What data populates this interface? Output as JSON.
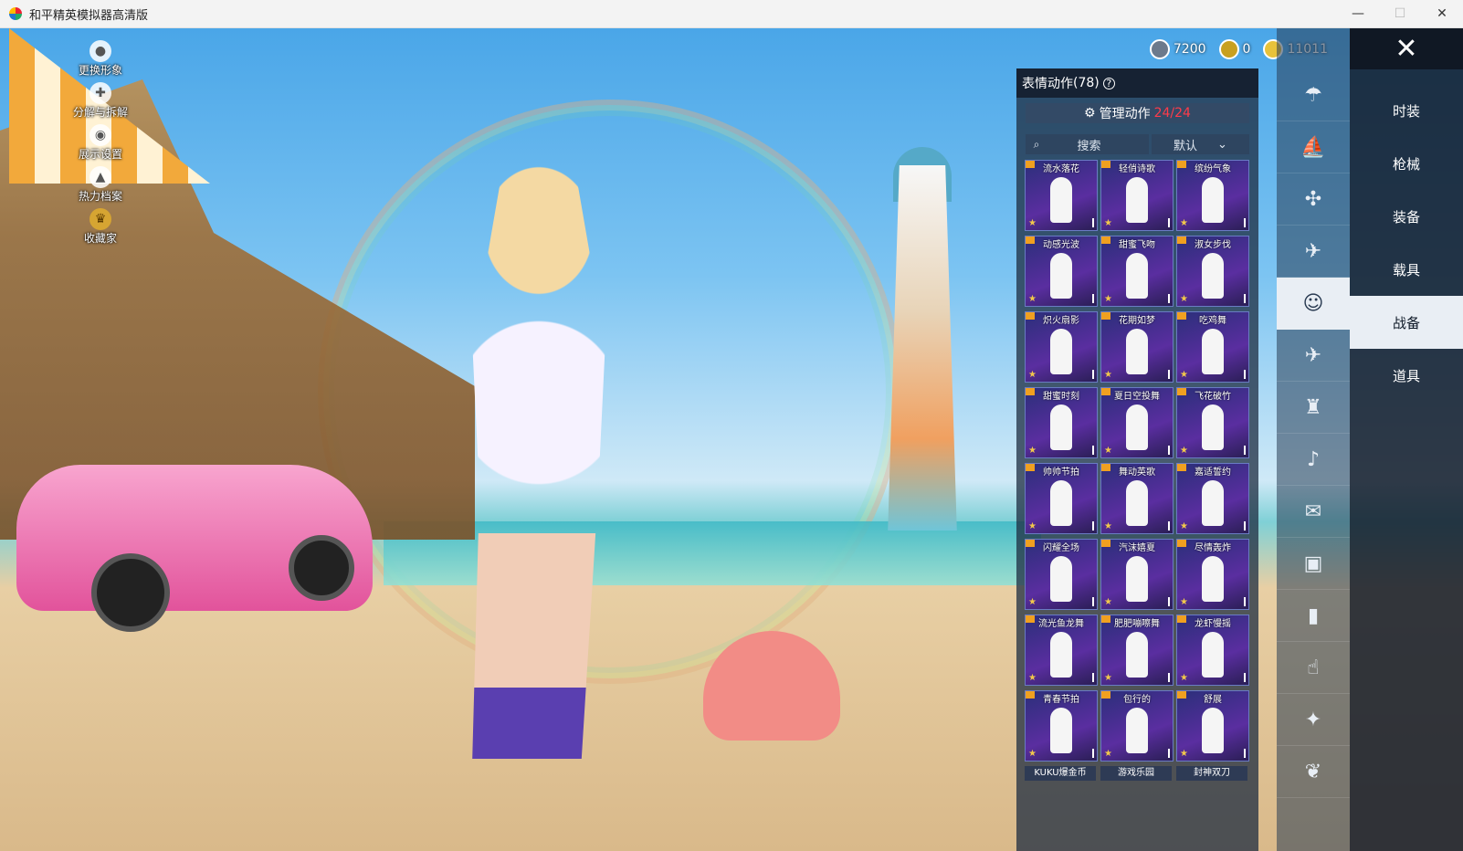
{
  "window": {
    "title": "和平精英模拟器高清版",
    "controls": {
      "minimize": "—",
      "maximize": "☐",
      "close": "✕"
    }
  },
  "left_menu": [
    {
      "label": "更换形象",
      "icon": "person-icon"
    },
    {
      "label": "分解与拆解",
      "icon": "puzzle-icon"
    },
    {
      "label": "展示设置",
      "icon": "eye-icon"
    },
    {
      "label": "热力档案",
      "icon": "flame-icon"
    },
    {
      "label": "收藏家",
      "icon": "medal-icon"
    }
  ],
  "currency": [
    {
      "value": "7200",
      "icon": "coupon-icon",
      "color": "#6c7a8c"
    },
    {
      "value": "0",
      "icon": "token-icon",
      "color": "#c8a020"
    },
    {
      "value": "11011",
      "icon": "coin-icon",
      "color": "#e8c23a"
    }
  ],
  "categories": {
    "close": "✕",
    "items": [
      "时装",
      "枪械",
      "装备",
      "载具",
      "战备",
      "道具"
    ],
    "active": "战备"
  },
  "sub_icons": [
    "parachute-icon",
    "boat-icon",
    "drone-icon",
    "plane-icon",
    "smiley-icon",
    "glider-icon",
    "robot-icon",
    "speaker-icon",
    "chat-icon",
    "photo-icon",
    "spray-icon",
    "hand-icon",
    "sparkle-icon",
    "bird-icon"
  ],
  "panel": {
    "title": "表情动作",
    "count": "(78)",
    "manage_label": "管理动作",
    "manage_count": "24/24",
    "search_placeholder": "搜索",
    "sort_value": "默认",
    "emotes": [
      "流水落花",
      "轻俏诗歌",
      "缤纷气象",
      "动感光波",
      "甜蜜飞吻",
      "淑女步伐",
      "炽火扇影",
      "花期如梦",
      "吃鸡舞",
      "甜蜜时刻",
      "夏日空投舞",
      "飞花破竹",
      "帅帅节拍",
      "舞动英歌",
      "嘉适誓约",
      "闪耀全场",
      "汽沫嬉夏",
      "尽情轰炸",
      "流光鱼龙舞",
      "肥肥嘣嚓舞",
      "龙虾慢摇",
      "青春节拍",
      "包行的",
      "舒展"
    ],
    "bottom_labels": [
      "KUKU爆金币",
      "游戏乐园",
      "封神双刀"
    ]
  }
}
